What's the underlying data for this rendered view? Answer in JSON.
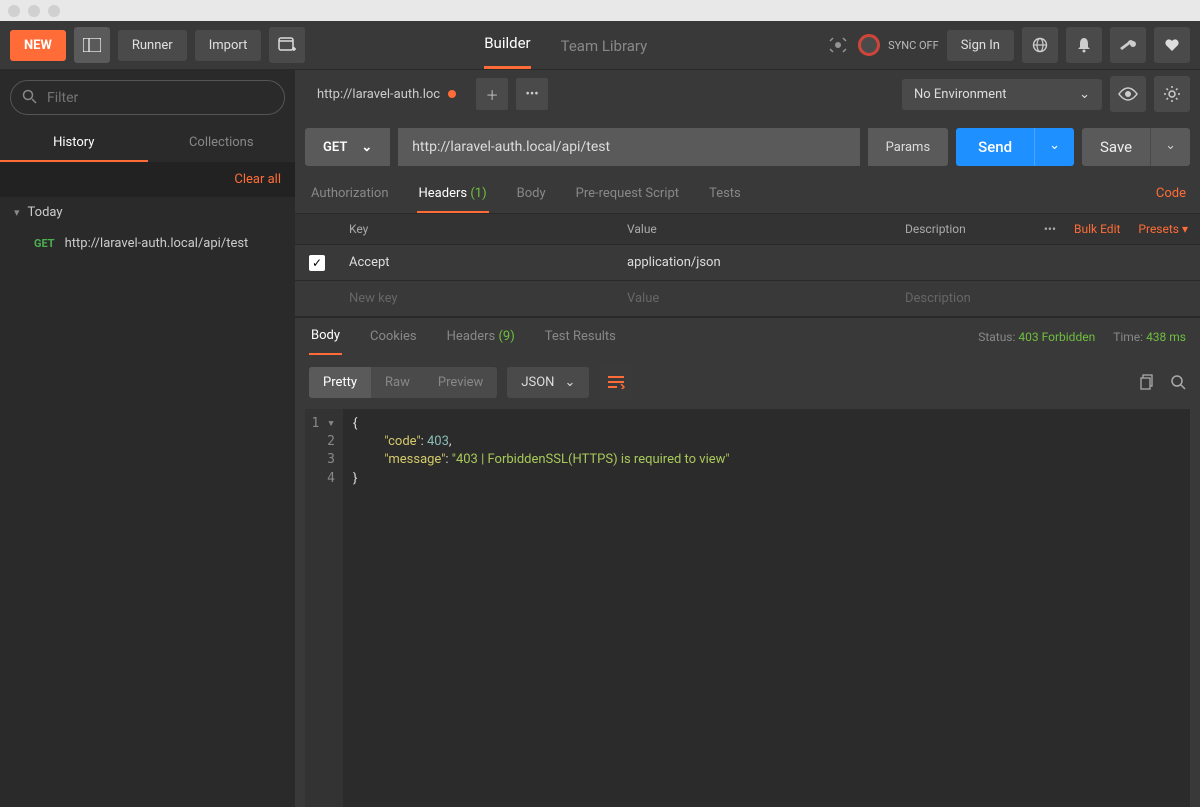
{
  "topbar": {
    "new": "NEW",
    "runner": "Runner",
    "import": "Import",
    "builder": "Builder",
    "teamlib": "Team Library",
    "sync": "SYNC OFF",
    "signin": "Sign In"
  },
  "sidebar": {
    "filter_placeholder": "Filter",
    "tab_history": "History",
    "tab_collections": "Collections",
    "clear_all": "Clear all",
    "group_today": "Today",
    "hist": {
      "method": "GET",
      "url": "http://laravel-auth.local/api/test"
    }
  },
  "req": {
    "tab_title": "http://laravel-auth.loc",
    "env": "No Environment",
    "method": "GET",
    "url": "http://laravel-auth.local/api/test",
    "params": "Params",
    "send": "Send",
    "save": "Save",
    "subtabs": {
      "auth": "Authorization",
      "headers": "Headers",
      "headers_count": "(1)",
      "body": "Body",
      "prescript": "Pre-request Script",
      "tests": "Tests"
    },
    "code_link": "Code",
    "table": {
      "col_key": "Key",
      "col_value": "Value",
      "col_desc": "Description",
      "bulk": "Bulk Edit",
      "presets": "Presets",
      "row1_key": "Accept",
      "row1_val": "application/json",
      "ph_key": "New key",
      "ph_val": "Value",
      "ph_desc": "Description"
    }
  },
  "resp": {
    "tabs": {
      "body": "Body",
      "cookies": "Cookies",
      "headers": "Headers",
      "headers_count": "(9)",
      "tests": "Test Results"
    },
    "status_label": "Status:",
    "status_val": "403 Forbidden",
    "time_label": "Time:",
    "time_val": "438 ms",
    "view": {
      "pretty": "Pretty",
      "raw": "Raw",
      "preview": "Preview",
      "json": "JSON"
    },
    "json": {
      "k1": "\"code\"",
      "v1": "403",
      "k2": "\"message\"",
      "v2": "\"403 | ForbiddenSSL(HTTPS) is required to view\""
    }
  }
}
